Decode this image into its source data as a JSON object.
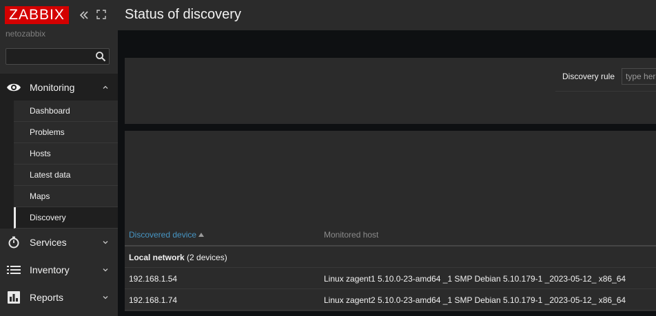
{
  "brand": {
    "logo_text": "ZABBIX",
    "server_name": "netozabbix",
    "accent": "#d40000"
  },
  "search": {
    "placeholder": "",
    "value": ""
  },
  "sidebar": {
    "sections": [
      {
        "label": "Monitoring",
        "icon": "eye-icon",
        "expanded": true,
        "items": [
          {
            "label": "Dashboard"
          },
          {
            "label": "Problems"
          },
          {
            "label": "Hosts"
          },
          {
            "label": "Latest data"
          },
          {
            "label": "Maps"
          },
          {
            "label": "Discovery",
            "selected": true
          }
        ]
      },
      {
        "label": "Services",
        "icon": "stopwatch-icon"
      },
      {
        "label": "Inventory",
        "icon": "list-icon"
      },
      {
        "label": "Reports",
        "icon": "bar-chart-icon"
      }
    ]
  },
  "header": {
    "title": "Status of discovery"
  },
  "filter": {
    "discovery_rule_label": "Discovery rule",
    "discovery_rule_placeholder": "type here"
  },
  "table": {
    "columns": {
      "device": "Discovered device",
      "host": "Monitored host",
      "sorted": "ascending"
    },
    "group": {
      "name": "Local network",
      "count": "(2 devices)"
    },
    "rows": [
      {
        "device": "192.168.1.54",
        "host": "Linux zagent1 5.10.0-23-amd64 _1 SMP Debian 5.10.179-1 _2023-05-12_ x86_64"
      },
      {
        "device": "192.168.1.74",
        "host": "Linux zagent2 5.10.0-23-amd64 _1 SMP Debian 5.10.179-1 _2023-05-12_ x86_64"
      }
    ]
  }
}
